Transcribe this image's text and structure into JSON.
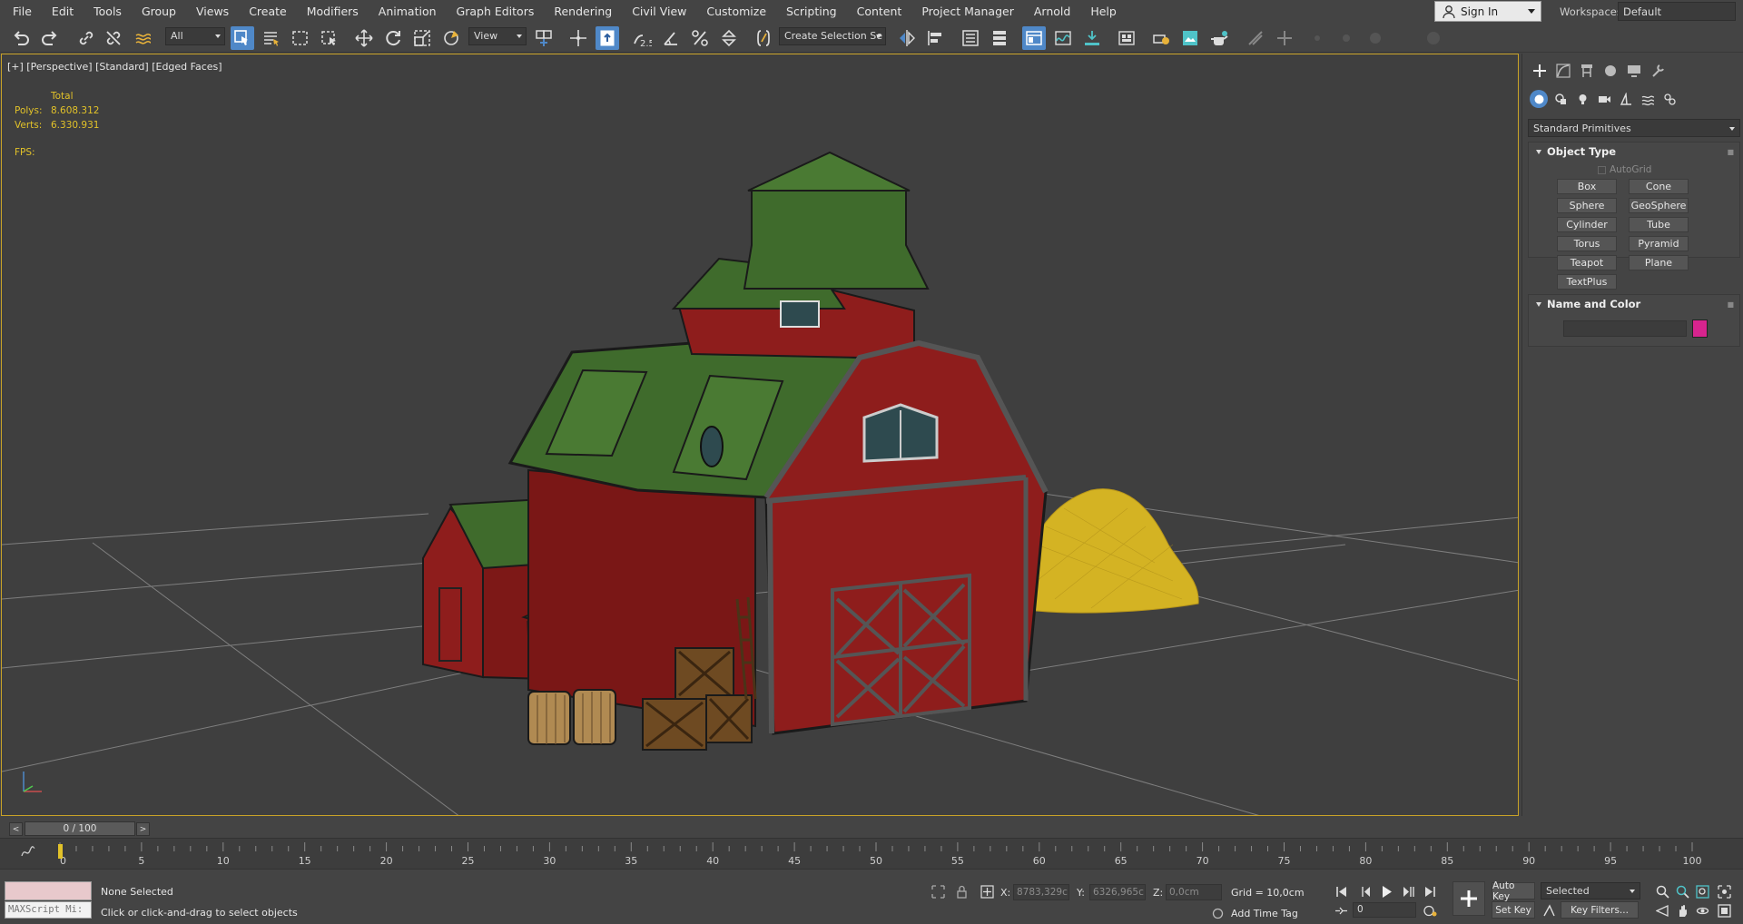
{
  "menu": [
    "File",
    "Edit",
    "Tools",
    "Group",
    "Views",
    "Create",
    "Modifiers",
    "Animation",
    "Graph Editors",
    "Rendering",
    "Civil View",
    "Customize",
    "Scripting",
    "Content",
    "Project Manager",
    "Arnold",
    "Help"
  ],
  "signin": {
    "label": "Sign In"
  },
  "workspaces": {
    "label": "Workspaces:",
    "value": "Default"
  },
  "toolbar": {
    "filter_value": "All",
    "coord_value": "View",
    "selection_set_value": "Create Selection Se",
    "snap_label": "2.5"
  },
  "viewport": {
    "label": "[+] [Perspective] [Standard] [Edged Faces]",
    "stats": {
      "header": "Total",
      "polys_label": "Polys:",
      "polys_value": "8.608.312",
      "verts_label": "Verts:",
      "verts_value": "6.330.931",
      "fps_label": "FPS:"
    },
    "colors": {
      "barn_red": "#8e1d1c",
      "roof_green": "#3f6b2c",
      "hay": "#d4b323",
      "border": "#c9a227"
    }
  },
  "command_panel": {
    "dropdown": "Standard Primitives",
    "object_type": {
      "title": "Object Type",
      "autogrid": "AutoGrid",
      "buttons": [
        "Box",
        "Cone",
        "Sphere",
        "GeoSphere",
        "Cylinder",
        "Tube",
        "Torus",
        "Pyramid",
        "Teapot",
        "Plane",
        "TextPlus"
      ]
    },
    "name_and_color": {
      "title": "Name and Color",
      "color": "#d7248e"
    }
  },
  "timeline": {
    "slider_label": "0 / 100",
    "ticks": [
      "0",
      "5",
      "10",
      "15",
      "20",
      "25",
      "30",
      "35",
      "40",
      "45",
      "50",
      "55",
      "60",
      "65",
      "70",
      "75",
      "80",
      "85",
      "90",
      "95",
      "100"
    ]
  },
  "status": {
    "listener": "MAXScript Mi:",
    "selection": "None Selected",
    "prompt": "Click or click-and-drag to select objects",
    "x_label": "X:",
    "x_value": "8783,329c",
    "y_label": "Y:",
    "y_value": "6326,965c",
    "z_label": "Z:",
    "z_value": "0,0cm",
    "grid": "Grid = 10,0cm",
    "add_time_tag": "Add Time Tag",
    "auto_key": "Auto Key",
    "set_key": "Set Key",
    "selected": "Selected",
    "key_filters": "Key Filters...",
    "frame": "0"
  }
}
